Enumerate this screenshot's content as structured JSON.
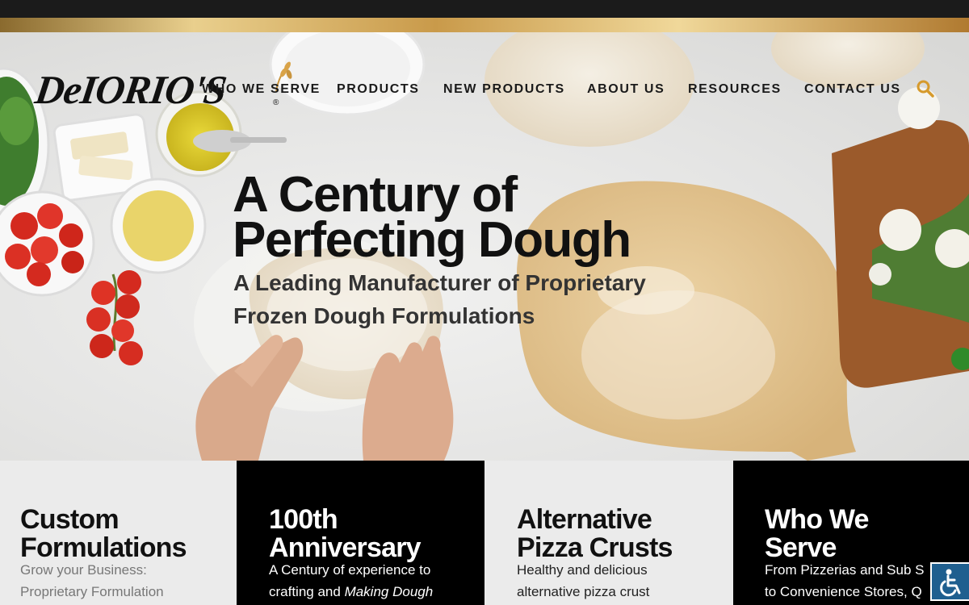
{
  "brand": {
    "logo_text": "DeIORIO'S",
    "registered": "®"
  },
  "nav": {
    "items": [
      "WHO WE SERVE",
      "PRODUCTS",
      "NEW PRODUCTS",
      "ABOUT US",
      "RESOURCES",
      "CONTACT US"
    ]
  },
  "search": {
    "icon": "search-icon",
    "color": "#d69a2c"
  },
  "hero": {
    "headline_line1": "A Century of",
    "headline_line2": "Perfecting Dough",
    "subheadline_line1": "A Leading Manufacturer of Proprietary",
    "subheadline_line2": "Frozen Dough Formulations"
  },
  "cards": [
    {
      "title_line1": "Custom",
      "title_line2": "Formulations",
      "text_line1": "Grow your Business:",
      "text_line2": "Proprietary Formulation",
      "theme": "light"
    },
    {
      "title_line1": "100th",
      "title_line2": "Anniversary",
      "text_line1": "A Century of experience to",
      "text_line2_plain": "crafting and ",
      "text_line2_italic": "Making Dough",
      "theme": "dark"
    },
    {
      "title_line1": "Alternative",
      "title_line2": "Pizza Crusts",
      "text_line1": "Healthy and delicious",
      "text_line2": "alternative pizza crust",
      "theme": "light"
    },
    {
      "title_line1": "Who We",
      "title_line2": "Serve",
      "text_line1": "From Pizzerias and Sub S",
      "text_line2": "to Convenience Stores, Q",
      "theme": "dark"
    }
  ],
  "accessibility": {
    "icon": "wheelchair-icon",
    "color": "#1f5f8f"
  },
  "colors": {
    "gold": "#d69a2c",
    "dark": "#1b1b1b"
  }
}
